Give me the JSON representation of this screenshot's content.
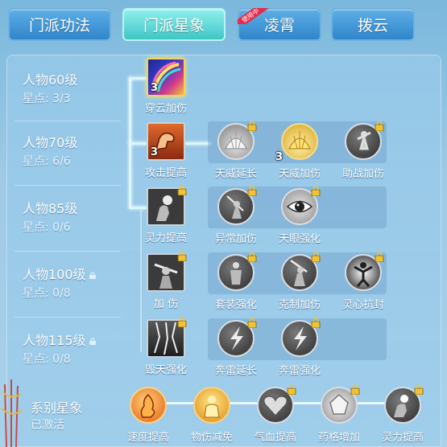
{
  "tabs": [
    {
      "label": "门派功法",
      "active": false
    },
    {
      "label": "门派星象",
      "active": true
    },
    {
      "label": "凌霄",
      "active": false,
      "badge": "使用中"
    },
    {
      "label": "拨云",
      "active": false
    }
  ],
  "levels": [
    {
      "title": "人物60级",
      "points": "星点: 3/3",
      "locked": false
    },
    {
      "title": "人物70级",
      "points": "星点: 6/6",
      "locked": false
    },
    {
      "title": "人物85级",
      "points": "星点: 0/6",
      "locked": false
    },
    {
      "title": "人物100级",
      "points": "星点: 0/8",
      "locked": true
    },
    {
      "title": "人物115级",
      "points": "星点: 0/8",
      "locked": true
    }
  ],
  "rows": [
    {
      "main": {
        "label": "穿云加伤",
        "count": "3",
        "icon": "rainbow-slash-icon",
        "locked": false
      },
      "subs": []
    },
    {
      "main": {
        "label": "攻击提高",
        "count": "3",
        "icon": "flex-arm-icon",
        "locked": false
      },
      "subs": [
        {
          "label": "天威延长",
          "count": "",
          "icon": "shell-burst-icon",
          "locked": true
        },
        {
          "label": "天威加伤",
          "count": "3",
          "icon": "golden-shell-icon",
          "locked": false
        },
        {
          "label": "助战加伤",
          "count": "",
          "icon": "warrior-strike-icon",
          "locked": true
        }
      ]
    },
    {
      "main": {
        "label": "灵力提高",
        "count": "",
        "icon": "glowing-hand-icon",
        "locked": true
      },
      "subs": [
        {
          "label": "异常加伤",
          "count": "",
          "icon": "sword-stance-icon",
          "locked": true
        },
        {
          "label": "天眼强化",
          "count": "",
          "icon": "eye-icon",
          "locked": true
        }
      ]
    },
    {
      "main": {
        "label": "加 伤",
        "count": "",
        "icon": "blade-warrior-icon",
        "locked": true
      },
      "subs": [
        {
          "label": "套装强化",
          "count": "",
          "icon": "armor-figure-icon",
          "locked": true
        },
        {
          "label": "克制加伤",
          "count": "",
          "icon": "raised-sword-icon",
          "locked": true
        },
        {
          "label": "灵心抗封",
          "count": "",
          "icon": "radiant-figure-icon",
          "locked": true
        }
      ]
    },
    {
      "main": {
        "label": "毁天强化",
        "count": "",
        "icon": "lightning-storm-icon",
        "locked": true
      },
      "subs": [
        {
          "label": "奔雷延长",
          "count": "",
          "icon": "lightning-bolt-icon",
          "locked": true
        },
        {
          "label": "奔雷强化",
          "count": "",
          "icon": "lightning-bolt-icon",
          "locked": true
        }
      ]
    }
  ],
  "series": {
    "title": "系别星象",
    "status": "已激活",
    "nodes": [
      {
        "label": "速度提高",
        "icon": "flame-boot-icon",
        "locked": false
      },
      {
        "label": "物伤减免",
        "icon": "golden-guard-icon",
        "locked": false
      },
      {
        "label": "气血提高",
        "icon": "heart-icon",
        "locked": true
      },
      {
        "label": "药格增加",
        "icon": "crystal-icon",
        "locked": true
      },
      {
        "label": "灵力提高",
        "icon": "glowing-hand-icon",
        "locked": true
      }
    ]
  }
}
